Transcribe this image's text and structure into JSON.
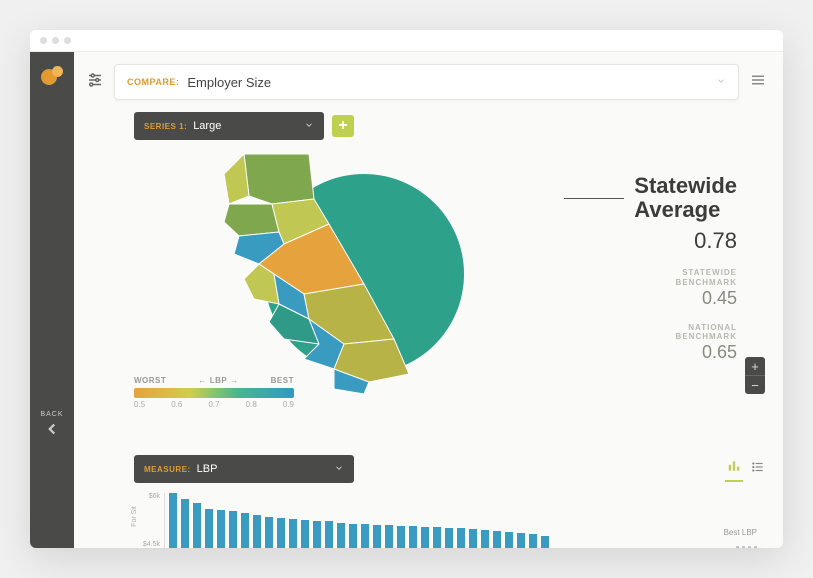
{
  "compare": {
    "label": "COMPARE:",
    "value": "Employer Size"
  },
  "series": {
    "label": "SERIES 1:",
    "value": "Large"
  },
  "add_label": "+",
  "stats": {
    "title_line1": "Statewide",
    "title_line2": "Average",
    "value": "0.78",
    "statewide": {
      "label1": "STATEWIDE",
      "label2": "BENCHMARK",
      "value": "0.45"
    },
    "national": {
      "label1": "NATIONAL",
      "label2": "BENCHMARK",
      "value": "0.65"
    }
  },
  "legend": {
    "worst": "WORST",
    "mid": "LBP",
    "best": "BEST",
    "ticks": [
      "0.5",
      "0.6",
      "0.7",
      "0.8",
      "0.9"
    ]
  },
  "measure": {
    "label": "MEASURE:",
    "value": "LBP"
  },
  "back": "BACK",
  "zoom": {
    "in": "+",
    "out": "−"
  },
  "chart_data": {
    "type": "bar",
    "ylabel": "For Sit",
    "ylim_labels": [
      "$6k",
      "$4.5k"
    ],
    "annotation": "Best LBP",
    "values": [
      58,
      52,
      48,
      42,
      41,
      40,
      38,
      36,
      34,
      33,
      32,
      31,
      30,
      30,
      29,
      28,
      28,
      27,
      27,
      26,
      26,
      25,
      25,
      24,
      24,
      23,
      22,
      21,
      20,
      19,
      18,
      16
    ]
  }
}
